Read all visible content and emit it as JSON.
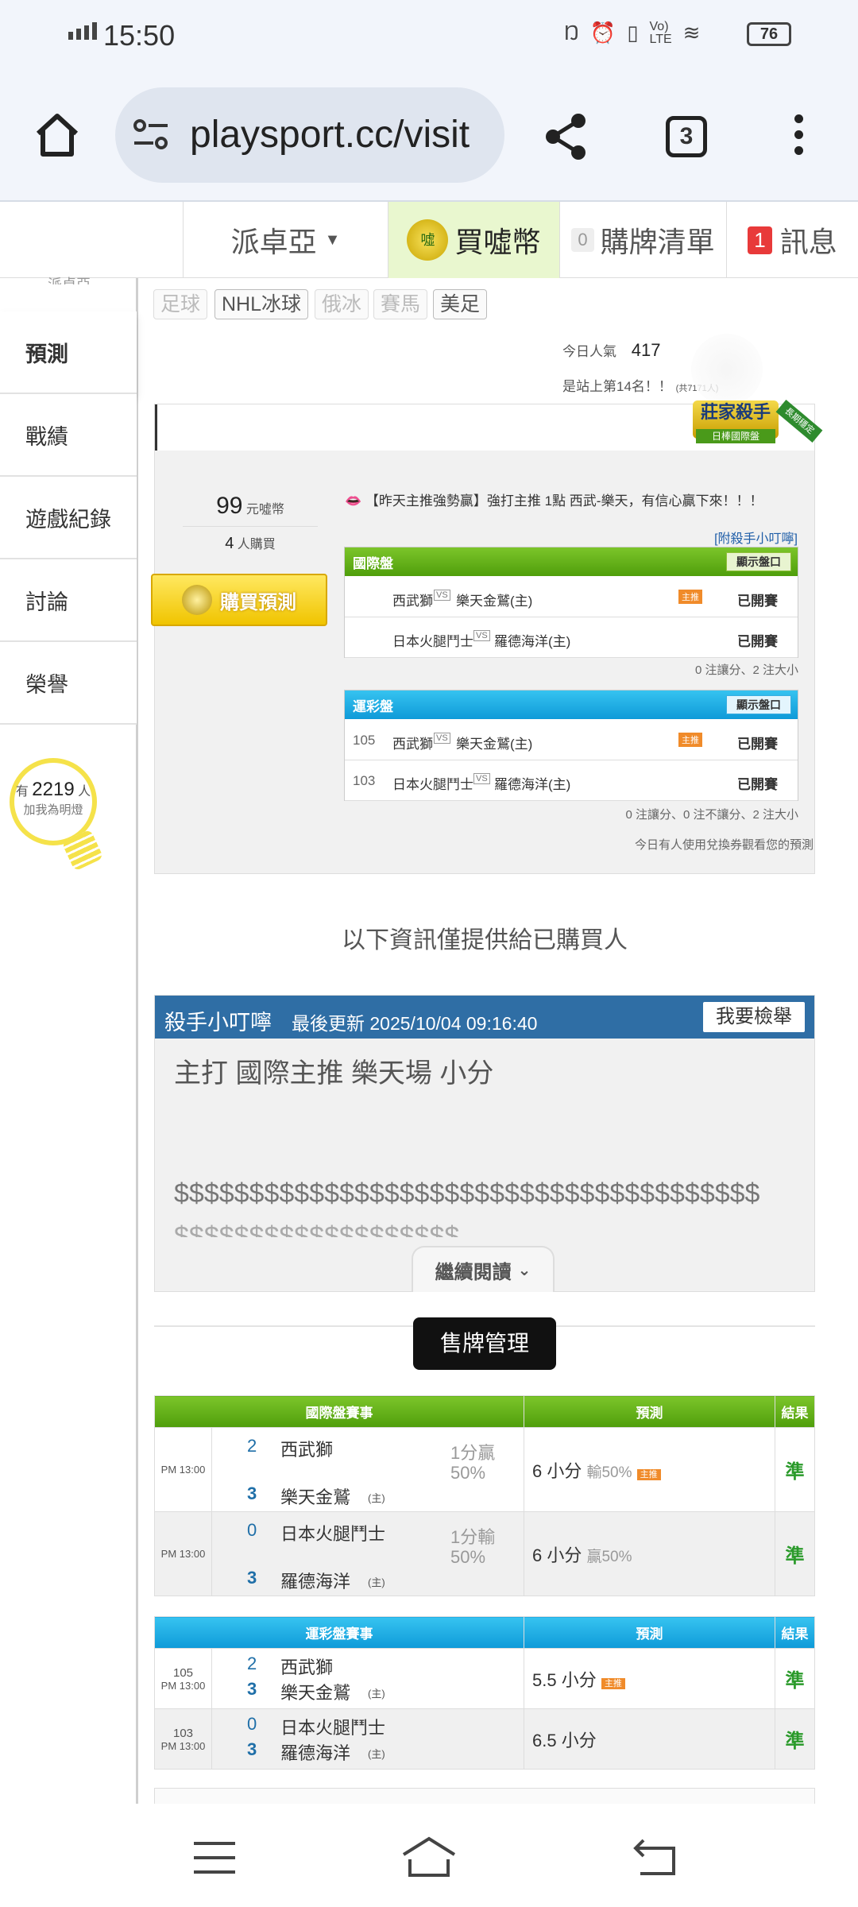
{
  "status_bar": {
    "time": "15:50",
    "battery": "76",
    "indicators": [
      "nfc-icon",
      "alarm-icon",
      "vibrate-icon",
      "volte-icon",
      "wifi-icon"
    ]
  },
  "browser": {
    "url": "playsport.cc/visit",
    "tabs_count": "3"
  },
  "top_nav": {
    "user": "派卓亞",
    "buy_coins": "買噓幣",
    "cart_count": "0",
    "cart_label": "購牌清單",
    "msg_count": "1",
    "msg_label": "訊息"
  },
  "sidebar": {
    "top_cut": "派卓亞",
    "items": [
      "預測",
      "戰績",
      "遊戲紀錄",
      "討論",
      "榮譽"
    ],
    "fans_prefix": "有",
    "fans_count": "2219",
    "fans_suffix": "人",
    "fans_note": "加我為明燈"
  },
  "sport_tags": [
    "足球",
    "NHL冰球",
    "俄冰",
    "賽馬",
    "美足"
  ],
  "popularity": {
    "label": "今日人氣",
    "value": "417",
    "rank": "是站上第14名！！",
    "total": "(共7171人)"
  },
  "badge": {
    "title": "莊家殺手",
    "sub": "日棒國際盤",
    "ribbon": "長期穩定"
  },
  "predict": {
    "price": "99",
    "price_unit": "元噓幣",
    "buyers": "4",
    "buyers_unit": "人購買",
    "buy_button": "購買預測",
    "headline": "【昨天主推強勢贏】強打主推 1點 西武-樂天，有信心贏下來！！！",
    "tips_link": "[附殺手小叮嚀]",
    "intl": {
      "title": "國際盤",
      "show": "顯示盤口",
      "rows": [
        {
          "away": "西武獅",
          "home": "樂天金鷲(主)",
          "host": "主推",
          "status": "已開賽"
        },
        {
          "away": "日本火腿鬥士",
          "home": "羅德海洋(主)",
          "host": "",
          "status": "已開賽"
        }
      ],
      "summary": "0 注讓分、2 注大小"
    },
    "lottery": {
      "title": "運彩盤",
      "show": "顯示盤口",
      "rows": [
        {
          "no": "105",
          "away": "西武獅",
          "home": "樂天金鷲(主)",
          "host": "主推",
          "status": "已開賽"
        },
        {
          "no": "103",
          "away": "日本火腿鬥士",
          "home": "羅德海洋(主)",
          "host": "",
          "status": "已開賽"
        }
      ],
      "summary": "0 注讓分、0 注不讓分、2 注大小"
    },
    "voucher_note": "今日有人使用兌換券觀看您的預測"
  },
  "buyers_only": "以下資訊僅提供給已購買人",
  "tips": {
    "title": "殺手小叮嚀",
    "updated": "最後更新 2025/10/04 09:16:40",
    "report": "我要檢舉",
    "line1": "主打 國際主推 樂天場 小分",
    "line2": "$$$$$$$$$$$$$$$$$$$$$$$$$$$$$$$$$$$$$$$",
    "line3": "$$$$$$$$$$$$$$$$$$$",
    "read_more": "繼續閱讀"
  },
  "sell_manage": "售牌管理",
  "intl_table": {
    "h_game": "國際盤賽事",
    "h_pred": "預測",
    "h_result": "結果",
    "rows": [
      {
        "time": "PM 13:00",
        "s1": "2",
        "t1": "西武獅",
        "s2": "3",
        "t2": "樂天金鷲",
        "home": "(主)",
        "line": "1分贏",
        "pct": "50%",
        "pred": "6 小分",
        "pred_note": "輸50%",
        "host": "主推",
        "result": "準"
      },
      {
        "time": "PM 13:00",
        "s1": "0",
        "t1": "日本火腿鬥士",
        "s2": "3",
        "t2": "羅德海洋",
        "home": "(主)",
        "line": "1分輸",
        "pct": "50%",
        "pred": "6 小分",
        "pred_note": "贏50%",
        "host": "",
        "result": "準"
      }
    ]
  },
  "lottery_table": {
    "h_game": "運彩盤賽事",
    "h_pred": "預測",
    "h_result": "結果",
    "rows": [
      {
        "no": "105",
        "time": "PM 13:00",
        "s1": "2",
        "t1": "西武獅",
        "s2": "3",
        "t2": "樂天金鷲",
        "home": "(主)",
        "pred": "5.5 小分",
        "host": "主推",
        "result": "準"
      },
      {
        "no": "103",
        "time": "PM 13:00",
        "s1": "0",
        "t1": "日本火腿鬥士",
        "s2": "3",
        "t2": "羅德海洋",
        "home": "(主)",
        "pred": "6.5 小分",
        "host": "",
        "result": "準"
      }
    ]
  },
  "colors": {
    "green": "#5aaa14",
    "blue": "#1aa8e6",
    "tips_header": "#2f6ea5",
    "buy_yellow": "#f5d000"
  }
}
